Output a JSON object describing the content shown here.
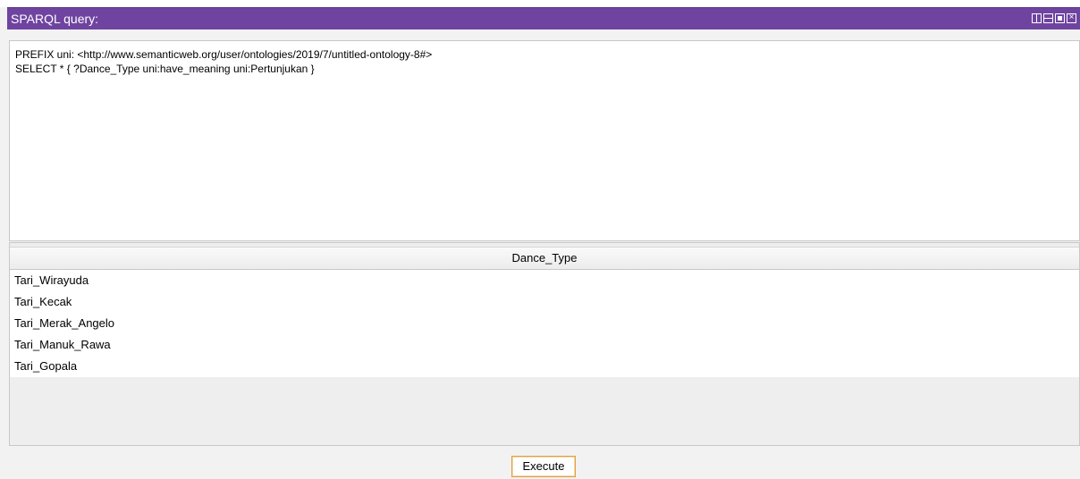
{
  "panel": {
    "title": "SPARQL query:",
    "controls": [
      "split-horizontal-icon",
      "split-vertical-icon",
      "maximize-icon",
      "close-icon"
    ],
    "accent_color": "#6f44a0"
  },
  "query": {
    "text": "PREFIX uni: <http://www.semanticweb.org/user/ontologies/2019/7/untitled-ontology-8#>\nSELECT * { ?Dance_Type uni:have_meaning uni:Pertunjukan }"
  },
  "results": {
    "columns": [
      "Dance_Type"
    ],
    "rows": [
      "Tari_Wirayuda",
      "Tari_Kecak",
      "Tari_Merak_Angelo",
      "Tari_Manuk_Rawa",
      "Tari_Gopala"
    ]
  },
  "execute": {
    "label": "Execute",
    "border_color": "#e0a040"
  }
}
